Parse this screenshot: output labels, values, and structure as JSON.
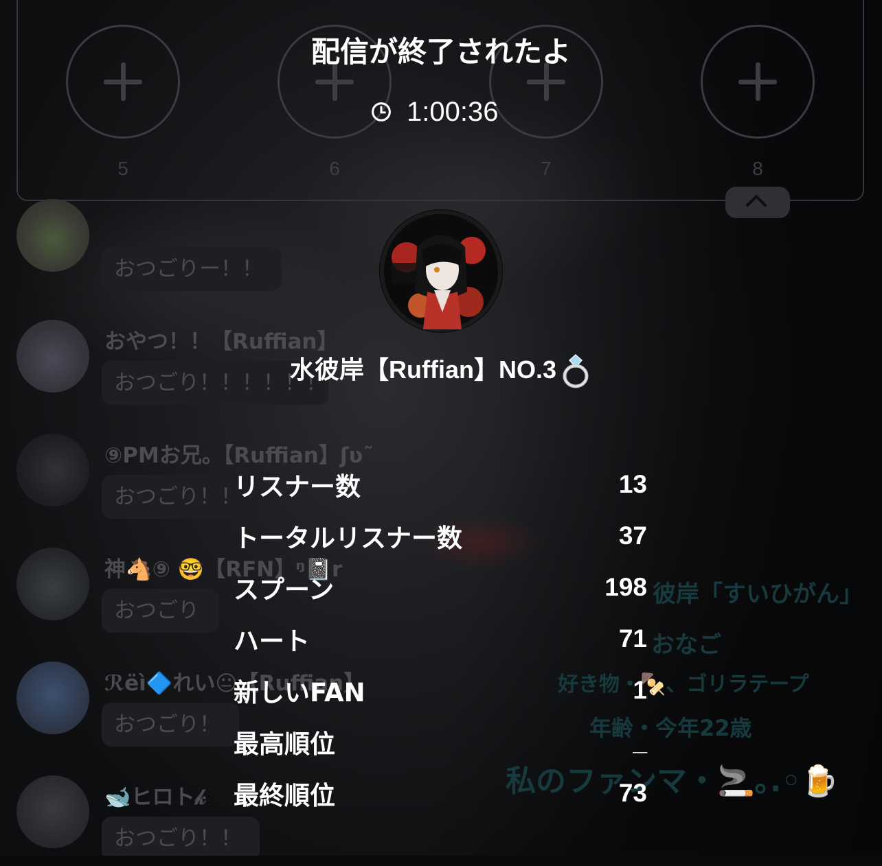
{
  "guest_slots": [
    {
      "number": "5"
    },
    {
      "number": "6"
    },
    {
      "number": "7"
    },
    {
      "number": "8"
    }
  ],
  "chat": [
    {
      "name": "",
      "message": "おつごりー！！"
    },
    {
      "name": "おやつ！！【Ruffian】",
      "message": "おつごり！！！！！！"
    },
    {
      "name": "⑨PMお兄。【Ruffian】ʃʋ˜",
      "message": "おつごり！！"
    },
    {
      "name": "神🐴⑨ 🤓【RFN】ᵑ📓r",
      "message": "おつごり"
    },
    {
      "name": "ℛëì🔷れい😐【Ruffian】",
      "message": "おつごり！"
    },
    {
      "name": "🐋ヒロト𝓀",
      "message": "おつごり！！"
    }
  ],
  "background_profile": {
    "line1": "彼岸「すいひがん」",
    "line2": "おなご",
    "line3": "好き物・🍢、ゴリラテープ",
    "line4": "年齢・今年22歳",
    "line5": "私のファンマ・🚬｡.◦🍺"
  },
  "result": {
    "title": "配信が終了されたよ",
    "duration": "1:00:36",
    "host_name": "水彼岸【Ruffian】NO.3",
    "stats": [
      {
        "label": "リスナー数",
        "value": "13"
      },
      {
        "label": "トータルリスナー数",
        "value": "37"
      },
      {
        "label": "スプーン",
        "value": "198"
      },
      {
        "label": "ハート",
        "value": "71"
      },
      {
        "label": "新しいFAN",
        "value": "1"
      },
      {
        "label": "最高順位",
        "value": "_"
      },
      {
        "label": "最終順位",
        "value": "73"
      }
    ]
  },
  "colors": {
    "text_primary": "#ffffff",
    "panel_border": "#34363a",
    "faded_text": "#4a4c50",
    "faded_accent": "#173a3f"
  }
}
